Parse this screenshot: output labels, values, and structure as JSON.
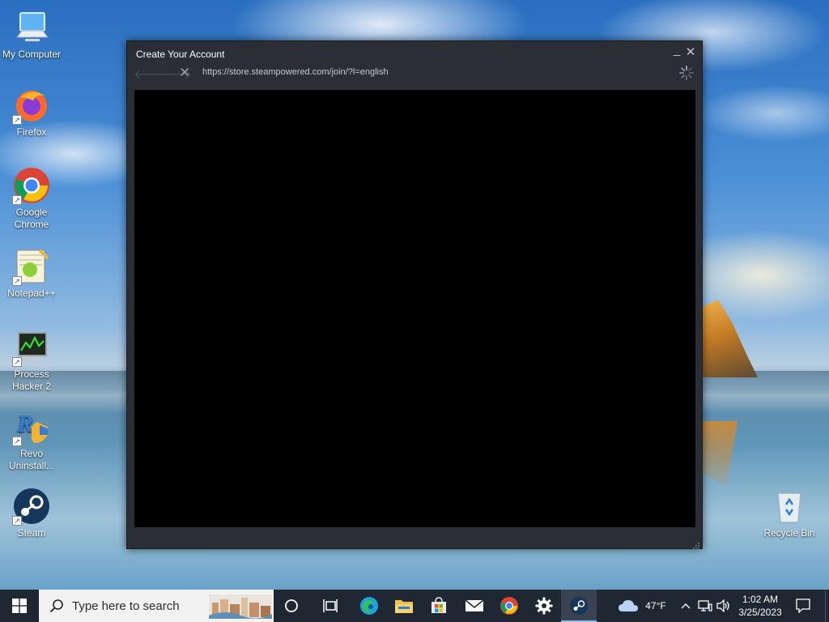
{
  "desktop": {
    "icons": [
      {
        "label": "My Computer"
      },
      {
        "label": "Firefox"
      },
      {
        "label": "Google Chrome"
      },
      {
        "label": "Notepad++"
      },
      {
        "label": "Process Hacker 2"
      },
      {
        "label": "Revo Uninstall..."
      },
      {
        "label": "Steam"
      },
      {
        "label": "Recycle Bin"
      }
    ]
  },
  "window": {
    "title": "Create Your Account",
    "minimize": "_",
    "close": "✕",
    "back": "🡐",
    "forward": "🡒",
    "stop": "✕",
    "url": "https://store.steampowered.com/join/?l=english"
  },
  "taskbar": {
    "search_placeholder": "Type here to search",
    "weather_temp": "47°F",
    "time": "1:02 AM",
    "date": "3/25/2023"
  }
}
